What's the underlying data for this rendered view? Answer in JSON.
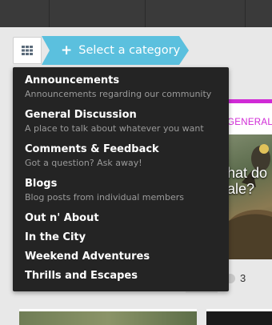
{
  "toolbar": {
    "select_category_label": "Select a category",
    "plus_symbol": "+",
    "grid_icon": "grid-icon",
    "accent_color": "#5bc0de"
  },
  "categories": [
    {
      "title": "Announcements",
      "description": "Announcements regarding our community"
    },
    {
      "title": "General Discussion",
      "description": "A place to talk about whatever you want"
    },
    {
      "title": "Comments & Feedback",
      "description": "Got a question? Ask away!"
    },
    {
      "title": "Blogs",
      "description": "Blog posts from individual members"
    },
    {
      "title": "Out n' About",
      "description": ""
    },
    {
      "title": "In the City",
      "description": ""
    },
    {
      "title": "Weekend Adventures",
      "description": ""
    },
    {
      "title": "Thrills and Escapes",
      "description": ""
    }
  ],
  "background_card": {
    "category_label": "GENERAL D",
    "overlay_text_line1": "hat do",
    "overlay_text_line2": "ale?",
    "comment_count": "3",
    "category_color": "#d02ad6"
  }
}
